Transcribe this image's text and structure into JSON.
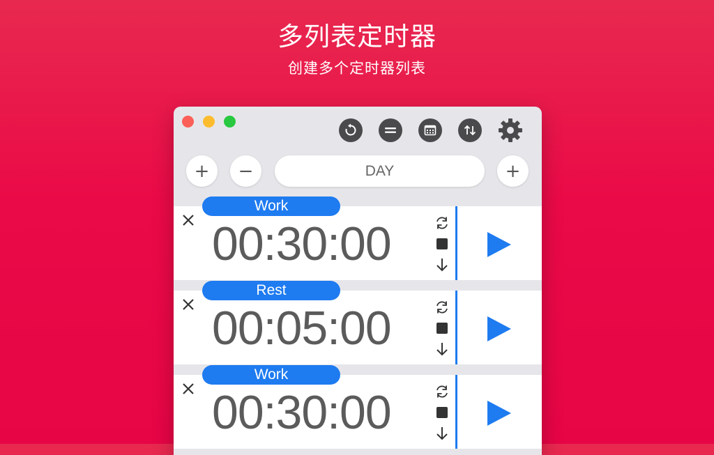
{
  "header": {
    "title": "多列表定时器",
    "subtitle": "创建多个定时器列表"
  },
  "toolbar": {
    "icons": [
      "reset-icon",
      "list-icon",
      "calendar-icon",
      "sort-icon",
      "gear-icon"
    ]
  },
  "controls": {
    "add_left": "+",
    "remove": "−",
    "list_name": "DAY",
    "add_right": "+"
  },
  "timers": [
    {
      "label": "Work",
      "time": "00:30:00"
    },
    {
      "label": "Rest",
      "time": "00:05:00"
    },
    {
      "label": "Work",
      "time": "00:30:00"
    }
  ],
  "colors": {
    "background": "#ea0a47",
    "accent": "#1e7bf0",
    "toolbar_button": "#4a4a4c"
  }
}
